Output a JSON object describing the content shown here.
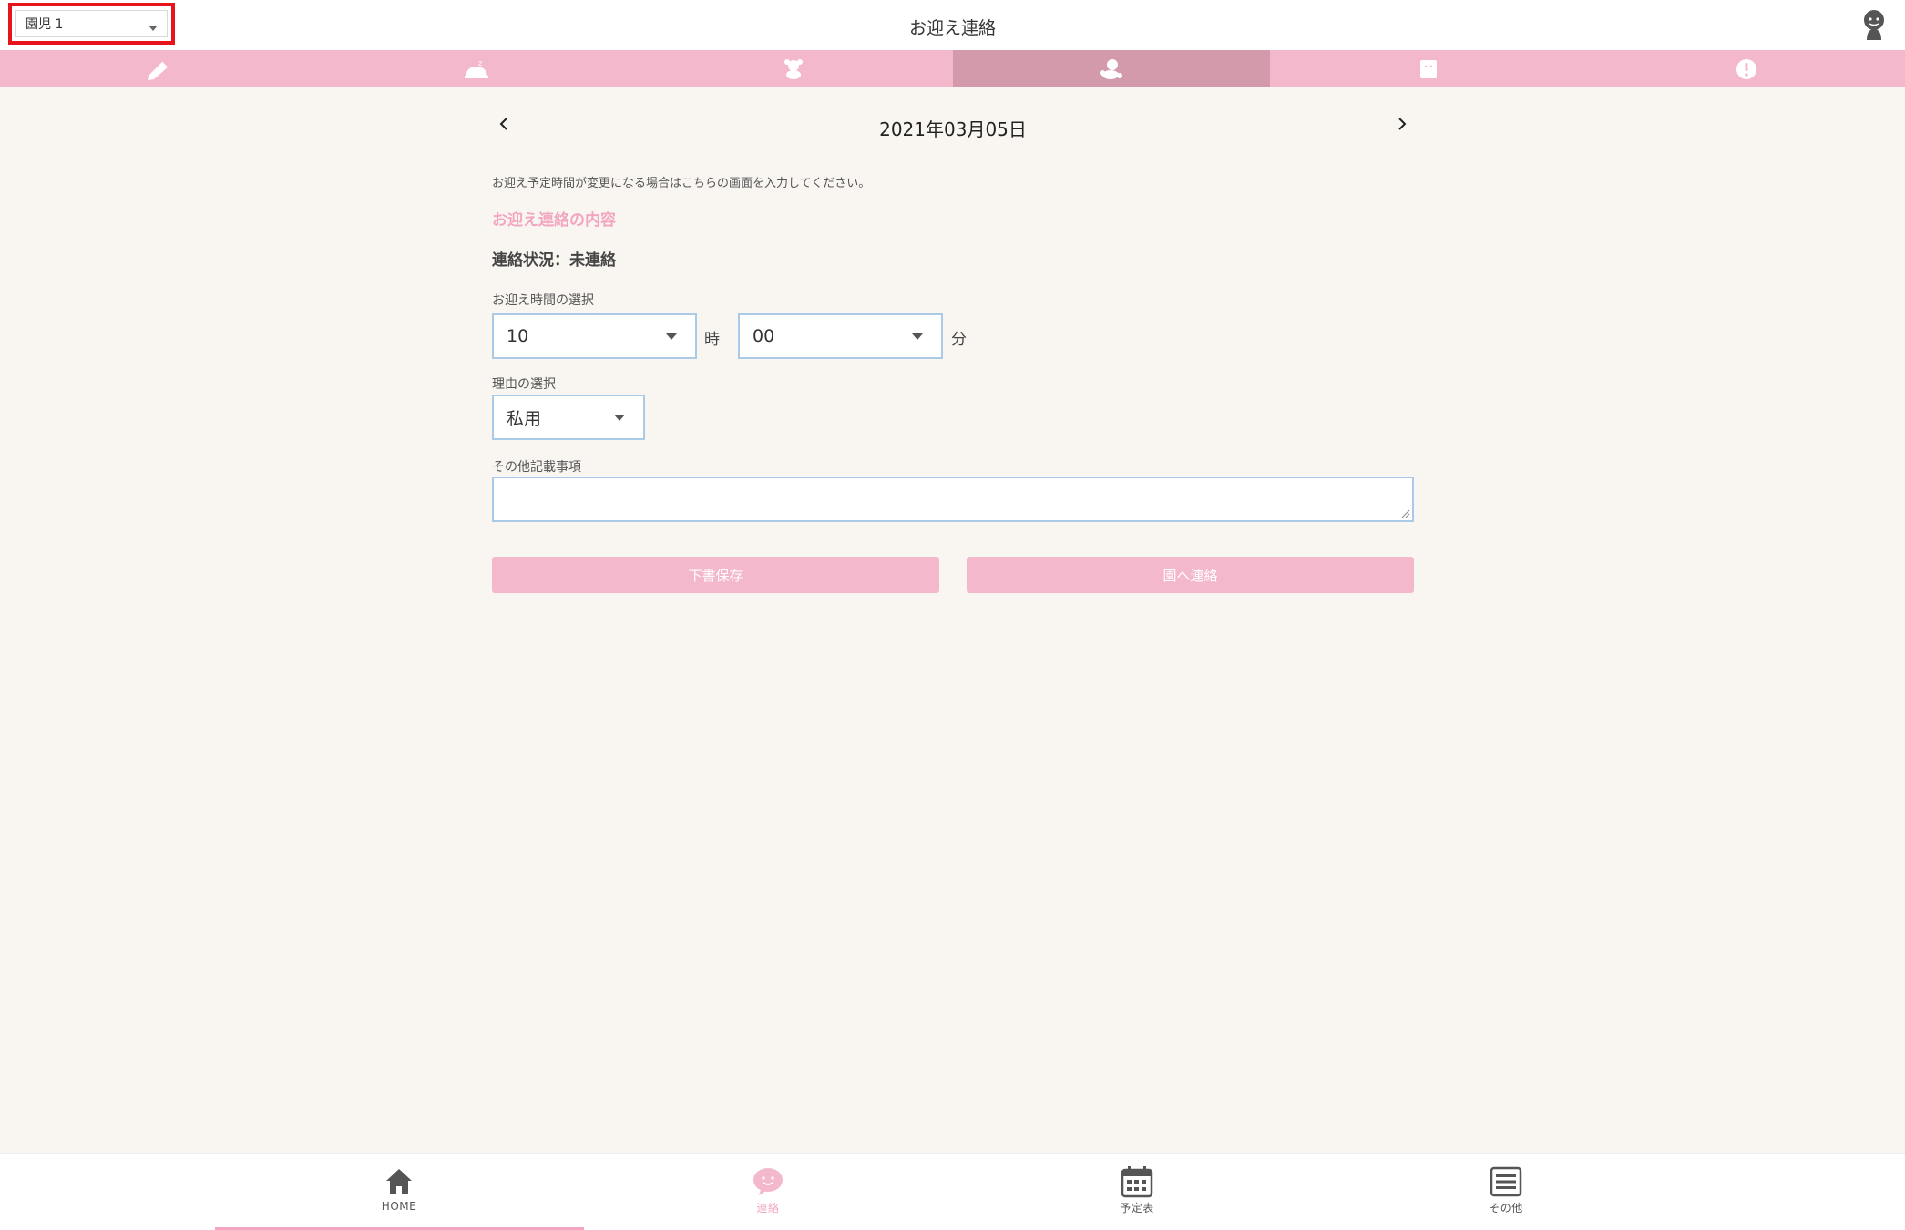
{
  "header": {
    "child_select_value": "園児 1",
    "title": "お迎え連絡",
    "user_icon": "user-avatar-icon"
  },
  "tabs": [
    {
      "icon": "pencil-icon",
      "active": false
    },
    {
      "icon": "sleeping-icon",
      "active": false
    },
    {
      "icon": "dog-icon",
      "active": false
    },
    {
      "icon": "pickup-icon",
      "active": true
    },
    {
      "icon": "calendar-day-icon",
      "active": false
    },
    {
      "icon": "alert-icon",
      "active": false
    }
  ],
  "date": {
    "label": "2021年03月05日",
    "prev_icon": "chevron-left-icon",
    "next_icon": "chevron-right-icon"
  },
  "form": {
    "info_text": "お迎え予定時間が変更になる場合はこちらの画面を入力してください。",
    "section_title": "お迎え連絡の内容",
    "status_text": "連絡状況：未連絡",
    "time_label": "お迎え時間の選択",
    "hour_value": "10",
    "hour_unit": "時",
    "minute_value": "00",
    "minute_unit": "分",
    "reason_label": "理由の選択",
    "reason_value": "私用",
    "notes_label": "その他記載事項",
    "notes_value": ""
  },
  "buttons": {
    "save_draft": "下書保存",
    "send": "園へ連絡"
  },
  "bottom_nav": [
    {
      "label": "HOME",
      "icon": "home-icon"
    },
    {
      "label": "連絡",
      "icon": "chat-icon"
    },
    {
      "label": "予定表",
      "icon": "calendar-icon"
    },
    {
      "label": "その他",
      "icon": "menu-icon"
    }
  ],
  "colors": {
    "accent_pink": "#f4b8cc",
    "active_tab": "#d29aab",
    "field_border": "#a9cbe8",
    "highlight_red": "#e8141c",
    "background": "#f9f6f2"
  }
}
